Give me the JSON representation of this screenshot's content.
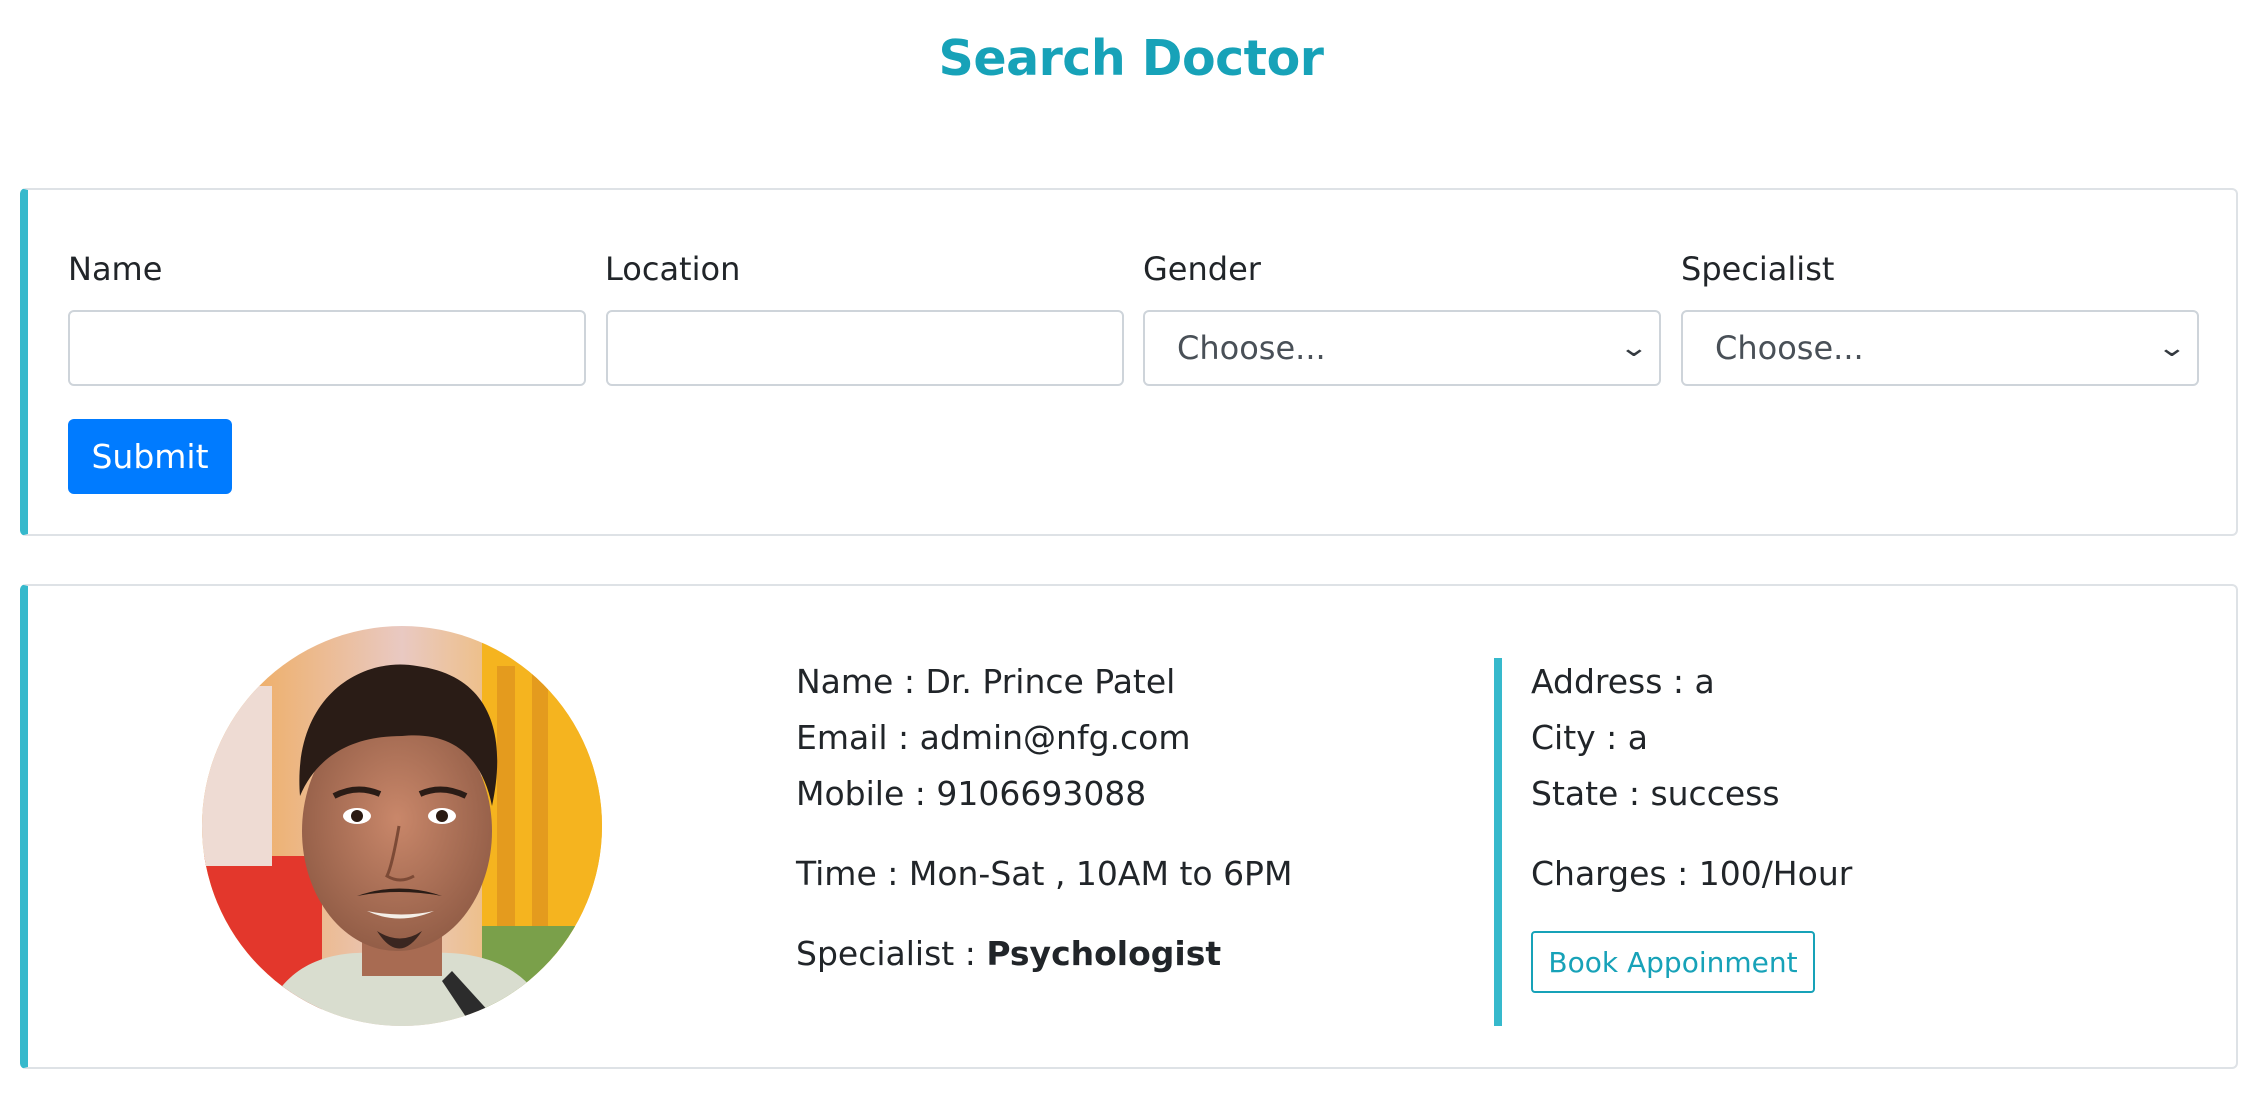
{
  "page": {
    "title": "Search Doctor"
  },
  "search_form": {
    "name_label": "Name",
    "name_value": "",
    "location_label": "Location",
    "location_value": "",
    "gender_label": "Gender",
    "gender_selected": "Choose...",
    "specialist_label": "Specialist",
    "specialist_selected": "Choose...",
    "submit_label": "Submit"
  },
  "doctor": {
    "name_line": "Name : Dr. Prince Patel",
    "email_line": "Email : admin@nfg.com",
    "mobile_line": "Mobile : 9106693088",
    "time_line": "Time : Mon-Sat , 10AM to 6PM",
    "specialist_prefix": "Specialist : ",
    "specialist_value": "Psychologist",
    "address_line": "Address : a",
    "city_line": "City : a",
    "state_line": "State : success",
    "charges_line": "Charges : 100/Hour",
    "book_label": "Book Appoinment"
  },
  "colors": {
    "accent": "#17a2b8",
    "primary": "#007bff",
    "card_border_accent": "#36b9cc"
  }
}
